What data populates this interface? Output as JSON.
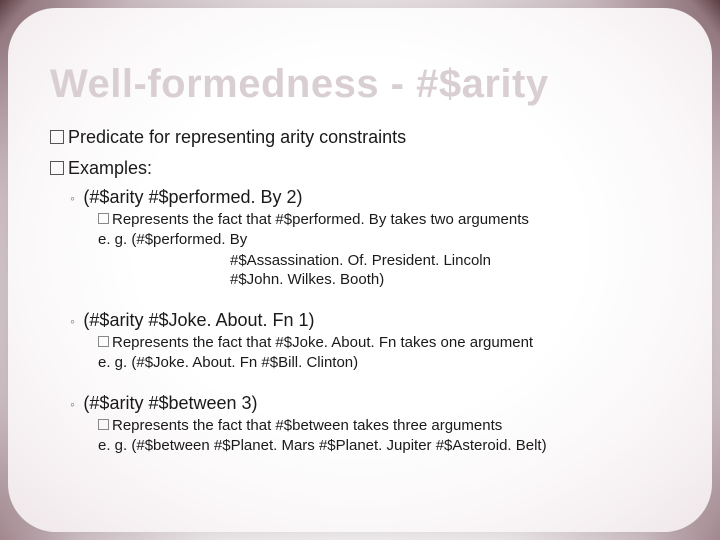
{
  "title": "Well-formedness - #$arity",
  "line1": "Predicate for representing arity constraints",
  "line2": "Examples:",
  "examples": [
    {
      "code": "(#$arity #$performed. By 2)",
      "desc": "Represents the fact that #$performed. By  takes two arguments",
      "eg": "e. g. (#$performed. By",
      "deep1": "#$Assassination. Of. President. Lincoln",
      "deep2": "#$John. Wilkes. Booth)"
    },
    {
      "code": "(#$arity #$Joke. About. Fn 1)",
      "desc": "Represents the fact that #$Joke. About. Fn takes one argument",
      "eg": "e. g. (#$Joke. About. Fn #$Bill. Clinton)"
    },
    {
      "code": "(#$arity #$between 3)",
      "desc": "Represents the fact that #$between takes three arguments",
      "eg": "e. g. (#$between #$Planet. Mars #$Planet. Jupiter #$Asteroid. Belt)"
    }
  ]
}
